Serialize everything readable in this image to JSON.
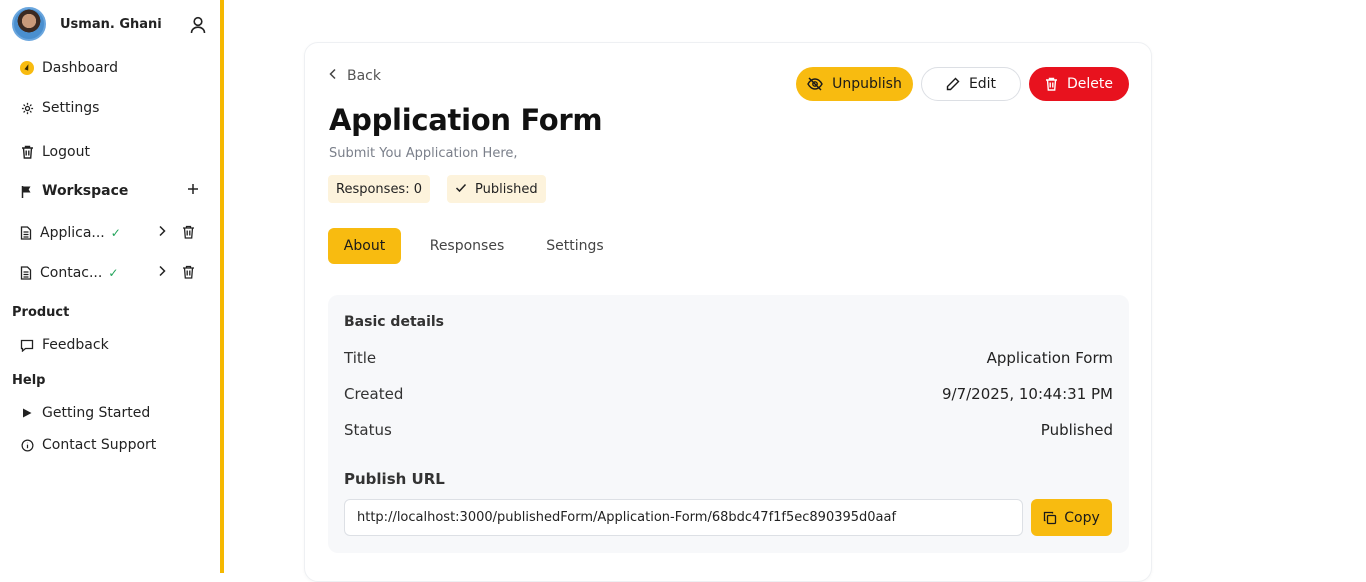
{
  "user": {
    "name": "Usman. Ghani"
  },
  "sidebar": {
    "dashboard": "Dashboard",
    "settings": "Settings",
    "logout": "Logout",
    "workspace": "Workspace",
    "forms": [
      {
        "label": "Applica..."
      },
      {
        "label": "Contac..."
      }
    ],
    "product_title": "Product",
    "feedback": "Feedback",
    "help_title": "Help",
    "getting_started": "Getting Started",
    "contact_support": "Contact Support"
  },
  "form": {
    "back": "Back",
    "title": "Application Form",
    "subtitle": "Submit You Application Here,",
    "responses_chip": "Responses: 0",
    "status_chip": "Published"
  },
  "actions": {
    "unpublish": "Unpublish",
    "edit": "Edit",
    "delete": "Delete"
  },
  "tabs": [
    "About",
    "Responses",
    "Settings"
  ],
  "details": {
    "heading": "Basic details",
    "rows": [
      {
        "label": "Title",
        "value": "Application Form"
      },
      {
        "label": "Created",
        "value": "9/7/2025, 10:44:31 PM"
      },
      {
        "label": "Status",
        "value": "Published"
      }
    ],
    "publish_url_label": "Publish URL",
    "publish_url": "http://localhost:3000/publishedForm/Application-Form/68bdc47f1f5ec890395d0aaf",
    "copy": "Copy"
  },
  "colors": {
    "accent": "#f8bb10",
    "danger": "#e8121e",
    "check": "#22a35a"
  }
}
